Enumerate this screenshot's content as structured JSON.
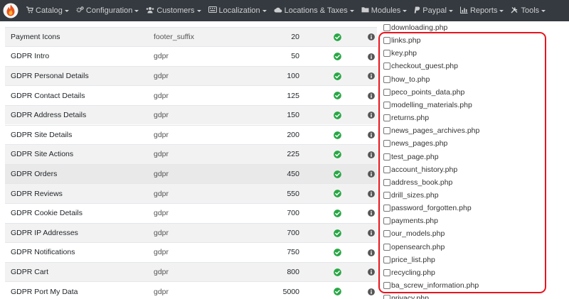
{
  "navbar": {
    "items": [
      {
        "label": "Catalog",
        "icon": "cart-icon"
      },
      {
        "label": "Configuration",
        "icon": "cogs-icon"
      },
      {
        "label": "Customers",
        "icon": "users-icon"
      },
      {
        "label": "Localization",
        "icon": "keyboard-icon"
      },
      {
        "label": "Locations & Taxes",
        "icon": "cloud-icon"
      },
      {
        "label": "Modules",
        "icon": "folder-icon"
      },
      {
        "label": "Paypal",
        "icon": "paypal-icon"
      },
      {
        "label": "Reports",
        "icon": "chart-icon"
      },
      {
        "label": "Tools",
        "icon": "tools-icon"
      }
    ]
  },
  "table": {
    "rows": [
      {
        "name": "Payment Icons",
        "code": "footer_suffix",
        "order": "20"
      },
      {
        "name": "GDPR Intro",
        "code": "gdpr",
        "order": "50"
      },
      {
        "name": "GDPR Personal Details",
        "code": "gdpr",
        "order": "100"
      },
      {
        "name": "GDPR Contact Details",
        "code": "gdpr",
        "order": "125"
      },
      {
        "name": "GDPR Address Details",
        "code": "gdpr",
        "order": "150"
      },
      {
        "name": "GDPR Site Details",
        "code": "gdpr",
        "order": "200"
      },
      {
        "name": "GDPR Site Actions",
        "code": "gdpr",
        "order": "225"
      },
      {
        "name": "GDPR Orders",
        "code": "gdpr",
        "order": "450"
      },
      {
        "name": "GDPR Reviews",
        "code": "gdpr",
        "order": "550"
      },
      {
        "name": "GDPR Cookie Details",
        "code": "gdpr",
        "order": "700"
      },
      {
        "name": "GDPR IP Addresses",
        "code": "gdpr",
        "order": "700"
      },
      {
        "name": "GDPR Notifications",
        "code": "gdpr",
        "order": "750"
      },
      {
        "name": "GDPR Cart",
        "code": "gdpr",
        "order": "800"
      },
      {
        "name": "GDPR Port My Data",
        "code": "gdpr",
        "order": "5000"
      }
    ]
  },
  "files": [
    "downloading.php",
    "links.php",
    "key.php",
    "checkout_guest.php",
    "how_to.php",
    "peco_points_data.php",
    "modelling_materials.php",
    "returns.php",
    "news_pages_archives.php",
    "news_pages.php",
    "test_page.php",
    "account_history.php",
    "address_book.php",
    "drill_sizes.php",
    "password_forgotten.php",
    "payments.php",
    "our_models.php",
    "opensearch.php",
    "price_list.php",
    "recycling.php",
    "ba_screw_information.php",
    "privacy.php"
  ],
  "colors": {
    "navbar_bg": "#343a40",
    "status_green": "#28a745",
    "info_gray": "#555555",
    "highlight_red": "#e8141e"
  }
}
